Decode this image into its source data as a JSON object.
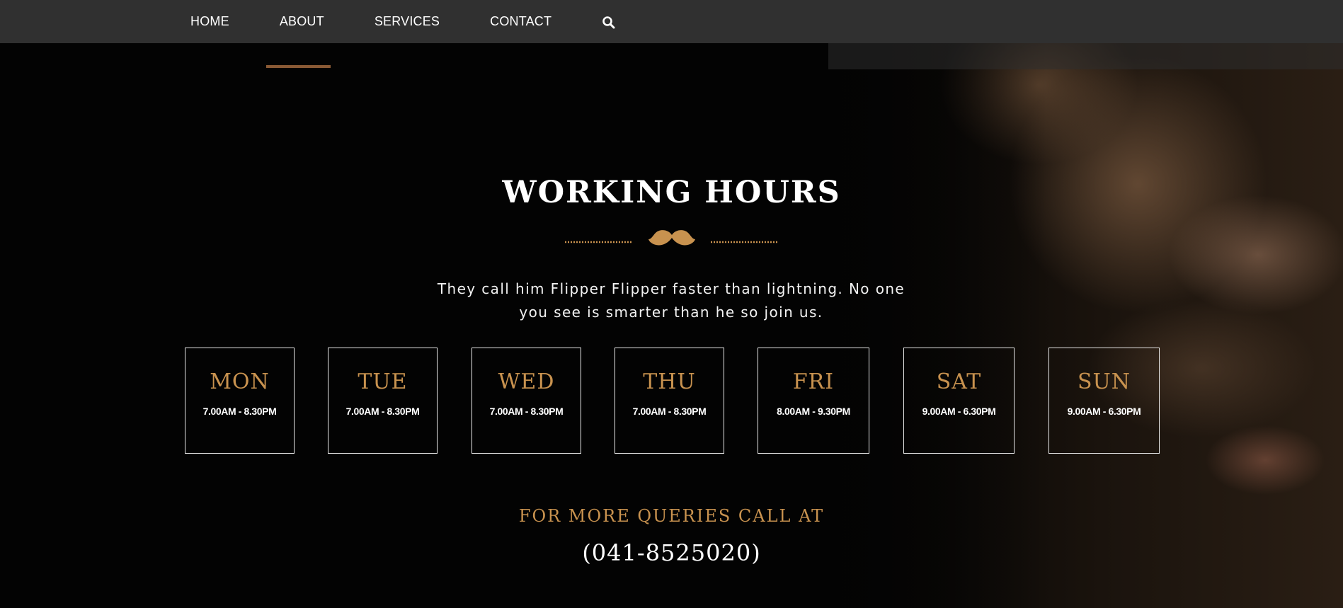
{
  "nav": {
    "items": [
      {
        "label": "HOME"
      },
      {
        "label": "ABOUT"
      },
      {
        "label": "SERVICES"
      },
      {
        "label": "CONTACT"
      }
    ],
    "active": "ABOUT",
    "search_icon": "search-icon"
  },
  "section": {
    "title": "WORKING HOURS",
    "divider_icon": "mustache-icon",
    "subtitle_line1": "They call him Flipper Flipper faster than lightning. No one",
    "subtitle_line2": "you see is smarter than he so join us."
  },
  "days": [
    {
      "name": "MON",
      "hours": "7.00AM - 8.30PM"
    },
    {
      "name": "TUE",
      "hours": "7.00AM - 8.30PM"
    },
    {
      "name": "WED",
      "hours": "7.00AM - 8.30PM"
    },
    {
      "name": "THU",
      "hours": "7.00AM - 8.30PM"
    },
    {
      "name": "FRI",
      "hours": "8.00AM - 9.30PM"
    },
    {
      "name": "SAT",
      "hours": "9.00AM - 6.30PM"
    },
    {
      "name": "SUN",
      "hours": "9.00AM - 6.30PM"
    }
  ],
  "contact": {
    "queries_label": "FOR MORE QUERIES CALL AT",
    "phone": "(041-8525020)"
  },
  "colors": {
    "accent": "#c8924f",
    "underline": "#8a5a35",
    "topbar": "#303030",
    "background": "#030303"
  }
}
